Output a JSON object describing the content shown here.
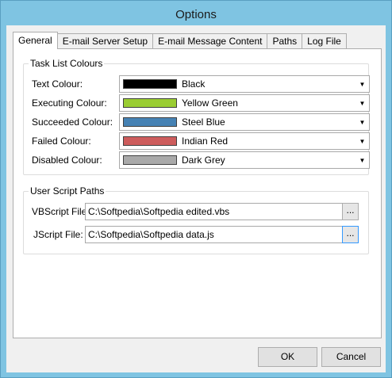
{
  "window": {
    "title": "Options"
  },
  "tabs": [
    {
      "label": "General",
      "active": true
    },
    {
      "label": "E-mail Server Setup",
      "active": false
    },
    {
      "label": "E-mail Message Content",
      "active": false
    },
    {
      "label": "Paths",
      "active": false
    },
    {
      "label": "Log File",
      "active": false
    }
  ],
  "task_colours": {
    "legend": "Task List Colours",
    "rows": [
      {
        "label": "Text Colour:",
        "value": "Black",
        "color": "#000000"
      },
      {
        "label": "Executing Colour:",
        "value": "Yellow Green",
        "color": "#9acd32"
      },
      {
        "label": "Succeeded Colour:",
        "value": "Steel Blue",
        "color": "#4682b4"
      },
      {
        "label": "Failed Colour:",
        "value": "Indian Red",
        "color": "#cd5c5c"
      },
      {
        "label": "Disabled Colour:",
        "value": "Dark Grey",
        "color": "#a9a9a9"
      }
    ]
  },
  "script_paths": {
    "legend": "User Script Paths",
    "vbscript_label": "VBScript File:",
    "vbscript_value": "C:\\Softpedia\\Softpedia edited.vbs",
    "jscript_label": "JScript File:",
    "jscript_value": "C:\\Softpedia\\Softpedia data.js",
    "browse_label": "..."
  },
  "buttons": {
    "ok": "OK",
    "cancel": "Cancel"
  }
}
